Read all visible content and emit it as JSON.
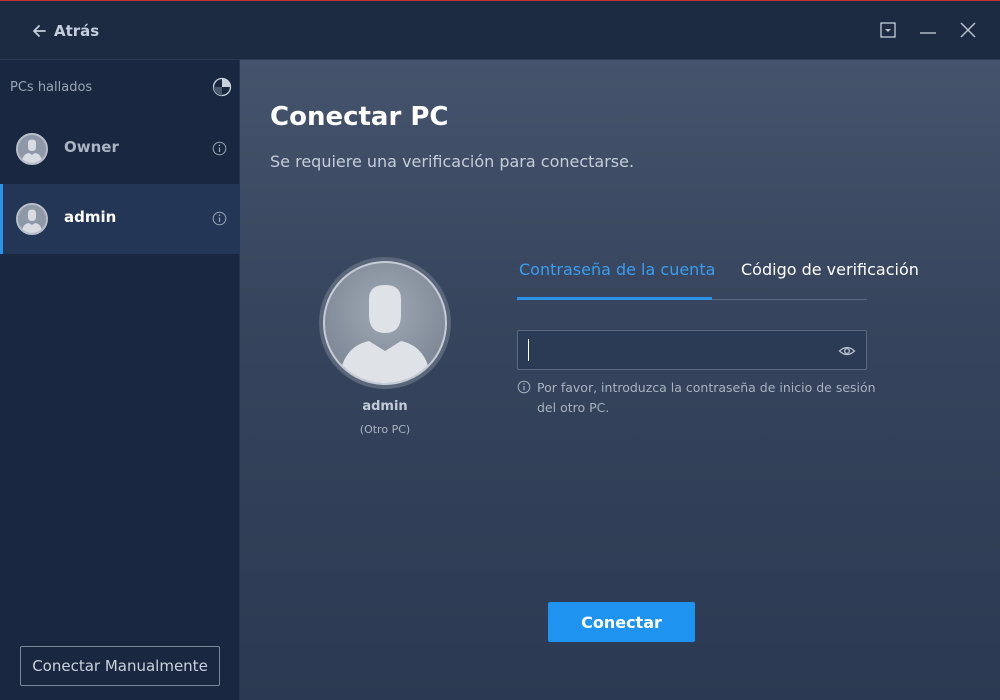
{
  "titlebar": {
    "back_label": "Atrás"
  },
  "sidebar": {
    "title": "PCs hallados",
    "items": [
      {
        "name": "Owner",
        "active": false
      },
      {
        "name": "admin",
        "active": true
      }
    ],
    "manual_button": "Conectar Manualmente"
  },
  "main": {
    "title": "Conectar PC",
    "subtitle": "Se requiere una verificación para conectarse.",
    "target": {
      "name": "admin",
      "sub": "(Otro PC)"
    },
    "tabs": [
      {
        "label": "Contraseña de la cuenta",
        "active": true
      },
      {
        "label": "Código de verificación",
        "active": false
      }
    ],
    "password": {
      "value": "",
      "placeholder": ""
    },
    "hint": "Por favor, introduzca la contraseña de inicio de sesión del otro PC.",
    "connect_button": "Conectar"
  },
  "colors": {
    "accent": "#1e94f0",
    "tab_active": "#3a9ef0",
    "sidebar_bg": "#1a2740",
    "main_bg": "#3a4862"
  },
  "icons": {
    "back": "arrow-left-icon",
    "menu": "dropdown-menu-icon",
    "minimize": "minimize-icon",
    "close": "close-icon",
    "refresh": "refresh-icon",
    "info": "info-icon",
    "eye": "eye-icon",
    "avatar": "user-avatar-icon"
  }
}
